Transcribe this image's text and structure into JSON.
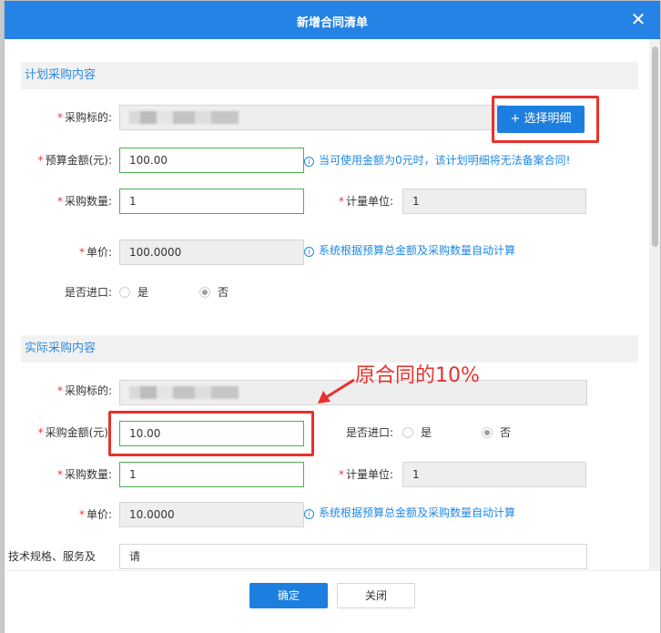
{
  "dialog": {
    "title": "新增合同清单",
    "close_icon": "close-icon"
  },
  "planned": {
    "section_title": "计划采购内容",
    "target_label": "采购标的:",
    "select_button": "+ 选择明细",
    "budget_label": "预算金额(元):",
    "budget_value": "100.00",
    "budget_hint": "当可使用金额为0元时，该计划明细将无法备案合同!",
    "qty_label": "采购数量:",
    "qty_value": "1",
    "unit_label": "计量单位:",
    "unit_value": "1",
    "price_label": "单价:",
    "price_value": "100.0000",
    "price_hint": "系统根据预算总金额及采购数量自动计算",
    "import_label": "是否进口:",
    "import_yes": "是",
    "import_no": "否"
  },
  "actual": {
    "section_title": "实际采购内容",
    "target_label": "采购标的:",
    "amount_label": "采购金额(元):",
    "amount_value": "10.00",
    "import_label": "是否进口:",
    "import_yes": "是",
    "import_no": "否",
    "qty_label": "采购数量:",
    "qty_value": "1",
    "unit_label": "计量单位:",
    "unit_value": "1",
    "price_label": "单价:",
    "price_value": "10.0000",
    "price_hint": "系统根据预算总金额及采购数量自动计算",
    "spec_label": "技术规格、服务及",
    "spec_value": "请"
  },
  "annotation": {
    "text": "原合同的10%",
    "color": "#e8312b"
  },
  "footer": {
    "ok": "确定",
    "close": "关闭"
  },
  "colors": {
    "accent": "#2483e5",
    "required": "#e53935",
    "hint": "#1e88e5"
  }
}
